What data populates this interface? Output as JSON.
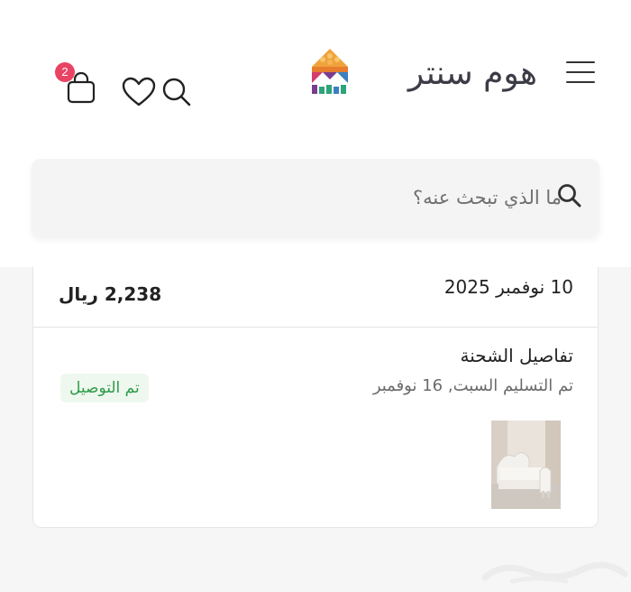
{
  "header": {
    "logo_text": "هوم سنتر",
    "logo_name": "home-centre-logo",
    "cart_count": "2"
  },
  "search": {
    "placeholder": "ما الذي تبحث عنه؟"
  },
  "order": {
    "date": "10 نوفمبر 2025",
    "total": "2,238 ريال",
    "shipment_title": "تفاصيل الشحنة",
    "delivery_text": "تم التسليم السبت, 16 نوفمبر",
    "status": "تم التوصيل",
    "product_image": "white-bed-thumbnail"
  },
  "colors": {
    "badge": "#e94363",
    "status_text": "#2e9b47",
    "status_bg": "#eef8ef",
    "page_bg": "#f6f6f7"
  },
  "icons": [
    "menu-icon",
    "search-icon",
    "heart-icon",
    "shopping-bag-icon"
  ]
}
